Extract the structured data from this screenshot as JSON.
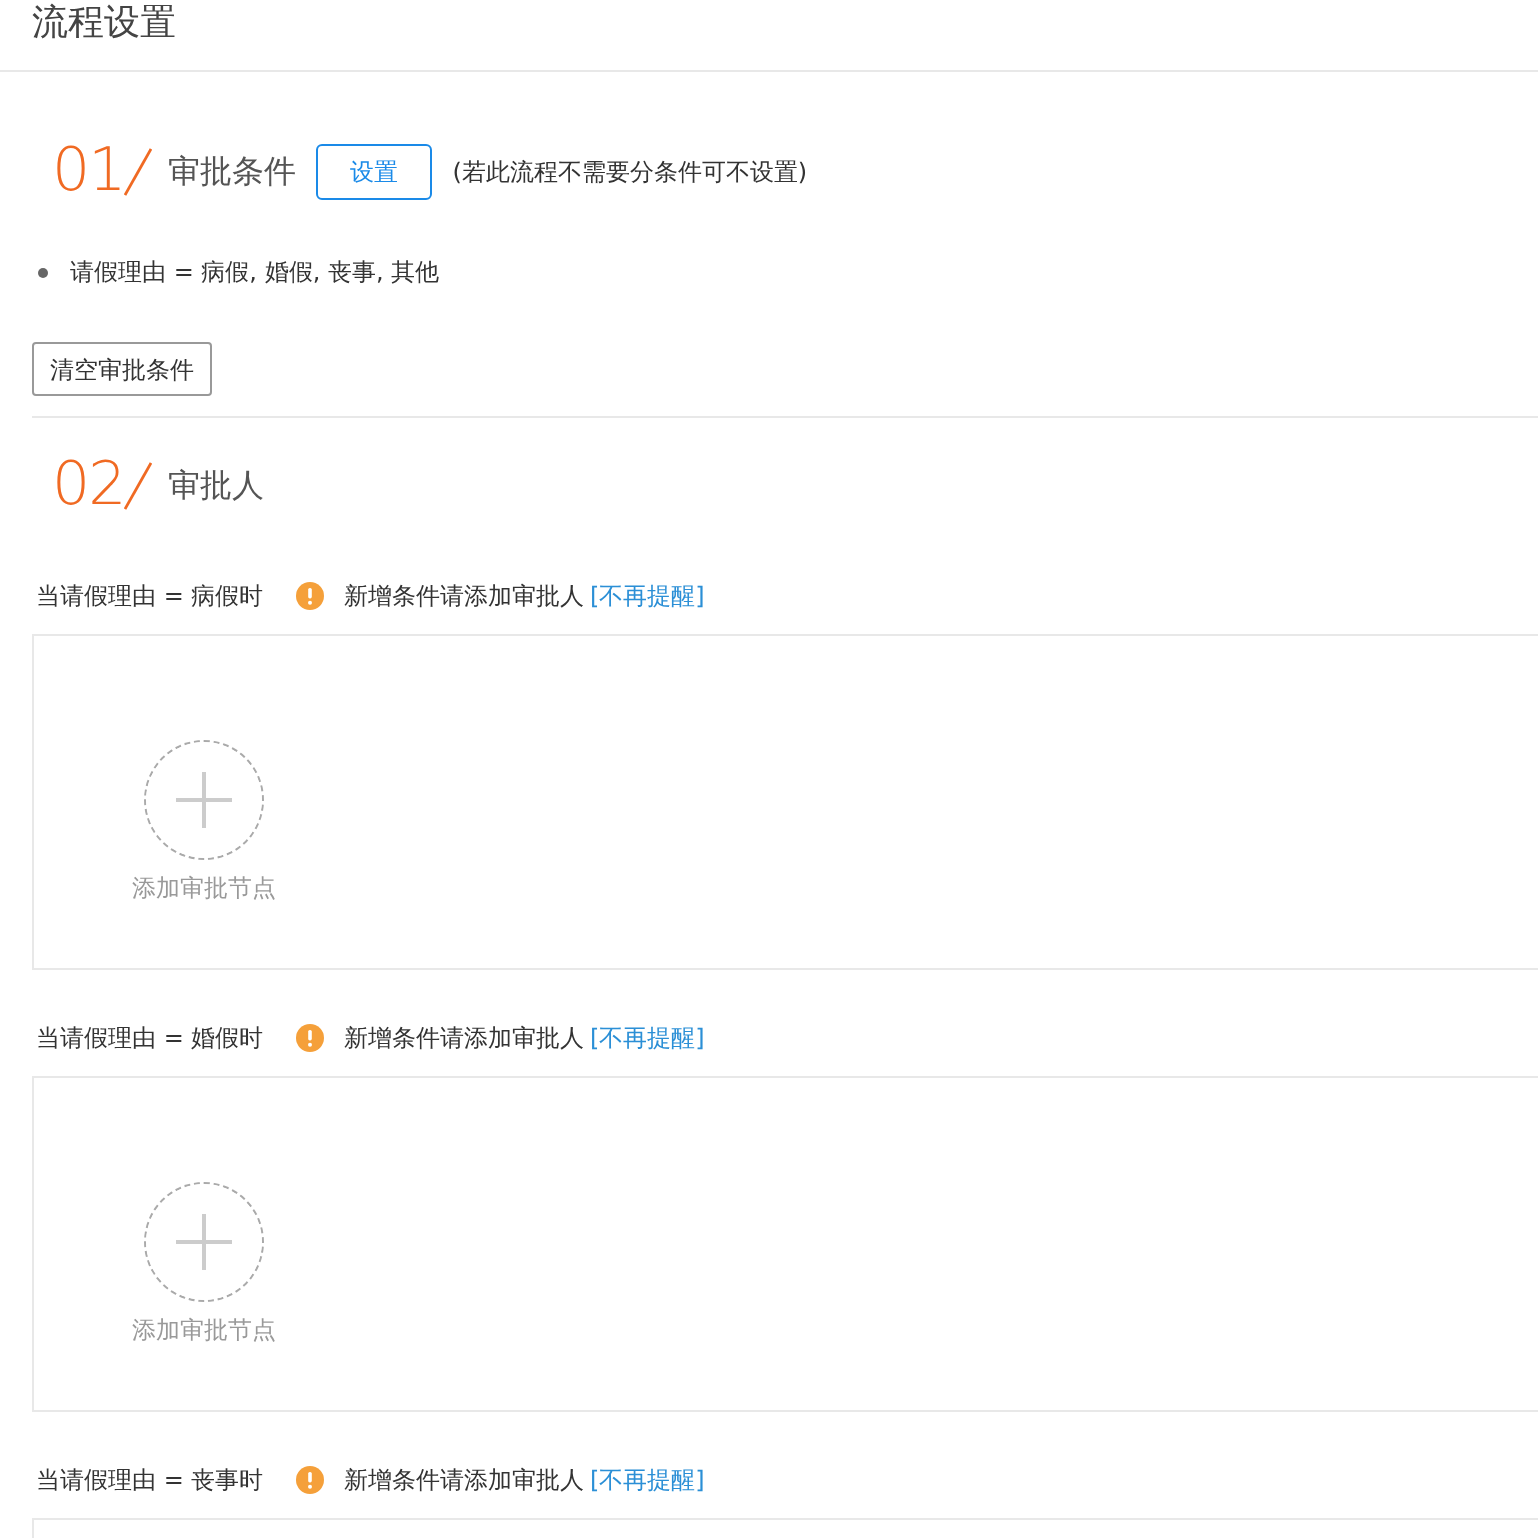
{
  "page": {
    "title": "流程设置"
  },
  "sections": [
    {
      "kind": "conditions",
      "number": "01",
      "title": "审批条件",
      "setup_button": "设置",
      "note": "(若此流程不需要分条件可不设置)",
      "conditions": [
        "请假理由 = 病假, 婚假, 丧事, 其他"
      ],
      "clear_button": "清空审批条件"
    },
    {
      "kind": "approvers",
      "number": "02",
      "title": "审批人",
      "branches": [
        {
          "condition": "当请假理由 = 病假时",
          "notice": "新增条件请添加审批人",
          "dismiss_link": "[不再提醒]",
          "add_node_label": "添加审批节点"
        },
        {
          "condition": "当请假理由 = 婚假时",
          "notice": "新增条件请添加审批人",
          "dismiss_link": "[不再提醒]",
          "add_node_label": "添加审批节点"
        },
        {
          "condition": "当请假理由 = 丧事时",
          "notice": "新增条件请添加审批人",
          "dismiss_link": "[不再提醒]"
        }
      ]
    }
  ]
}
